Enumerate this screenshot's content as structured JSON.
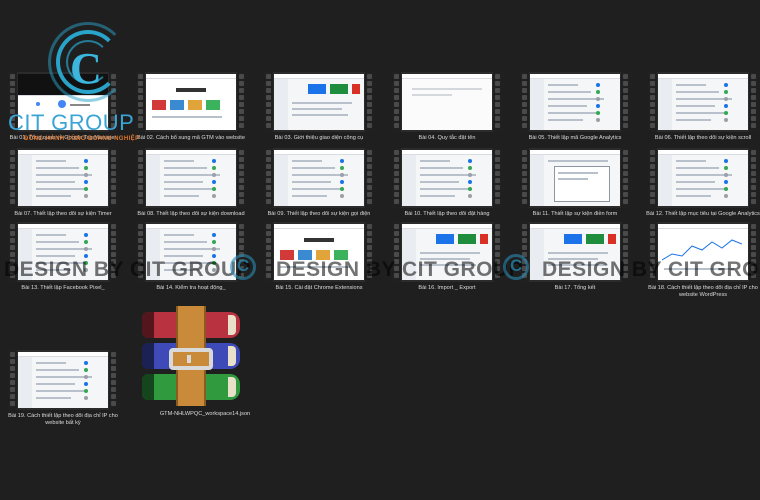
{
  "files": [
    {
      "caption": "Bài 01. Tổng quan về Google Tag Manager",
      "style": "intro"
    },
    {
      "caption": "Bài 02. Cách bổ sung mã GTM vào website",
      "style": "shop"
    },
    {
      "caption": "Bài 03. Giới thiệu giao diện công cụ",
      "style": "cards"
    },
    {
      "caption": "Bài 04. Quy tắc đặt tên",
      "style": "blank"
    },
    {
      "caption": "Bài 05. Thiết lập mã Google Analytics",
      "style": "list"
    },
    {
      "caption": "Bài 06. Thiết lập theo dõi sự kiện scroll",
      "style": "list"
    },
    {
      "caption": "Bài 07. Thiết lập theo dõi sự kiện Timer",
      "style": "list"
    },
    {
      "caption": "Bài 08. Thiết lập theo dõi sự kiện download",
      "style": "list"
    },
    {
      "caption": "Bài 09. Thiết lập theo dõi sự kiện gọi điện",
      "style": "list"
    },
    {
      "caption": "Bài 10. Thiết lập theo dõi đặt hàng",
      "style": "list"
    },
    {
      "caption": "Bài 11. Thiết lập sự kiện điền form",
      "style": "window"
    },
    {
      "caption": "Bài 12. Thiết lập mục tiêu tại Google Analytics",
      "style": "list"
    },
    {
      "caption": "Bài 13. Thiết lập Facebook Pixel_",
      "style": "list"
    },
    {
      "caption": "Bài 14. Kiểm tra hoạt động_",
      "style": "list"
    },
    {
      "caption": "Bài 15. Cài đặt Chrome Extensions",
      "style": "shop"
    },
    {
      "caption": "Bài 16. Import _ Export",
      "style": "cards"
    },
    {
      "caption": "Bài 17. Tổng kết",
      "style": "cards"
    },
    {
      "caption": "Bài 18. Cách thiết lập theo dõi địa chỉ IP cho website WordPress",
      "style": "chart"
    },
    {
      "caption": "Bài 19. Cách thiết lập theo dõi địa chỉ IP cho website bất kỳ",
      "style": "list"
    }
  ],
  "archive": {
    "caption": "GTM-NHLWPQC_workspace14.json",
    "icon": "winrar-archive-icon"
  },
  "logo": {
    "name": "CIT GROUP",
    "tagline": "ĐỒNG HÀNH CÙNG DOANH NGHIỆP"
  },
  "watermark": {
    "text": "DESIGN BY CIT GROUP"
  },
  "colors": {
    "background": "#1f1f1f",
    "accent": "#2aa3c9",
    "tagline": "#e0762b"
  }
}
